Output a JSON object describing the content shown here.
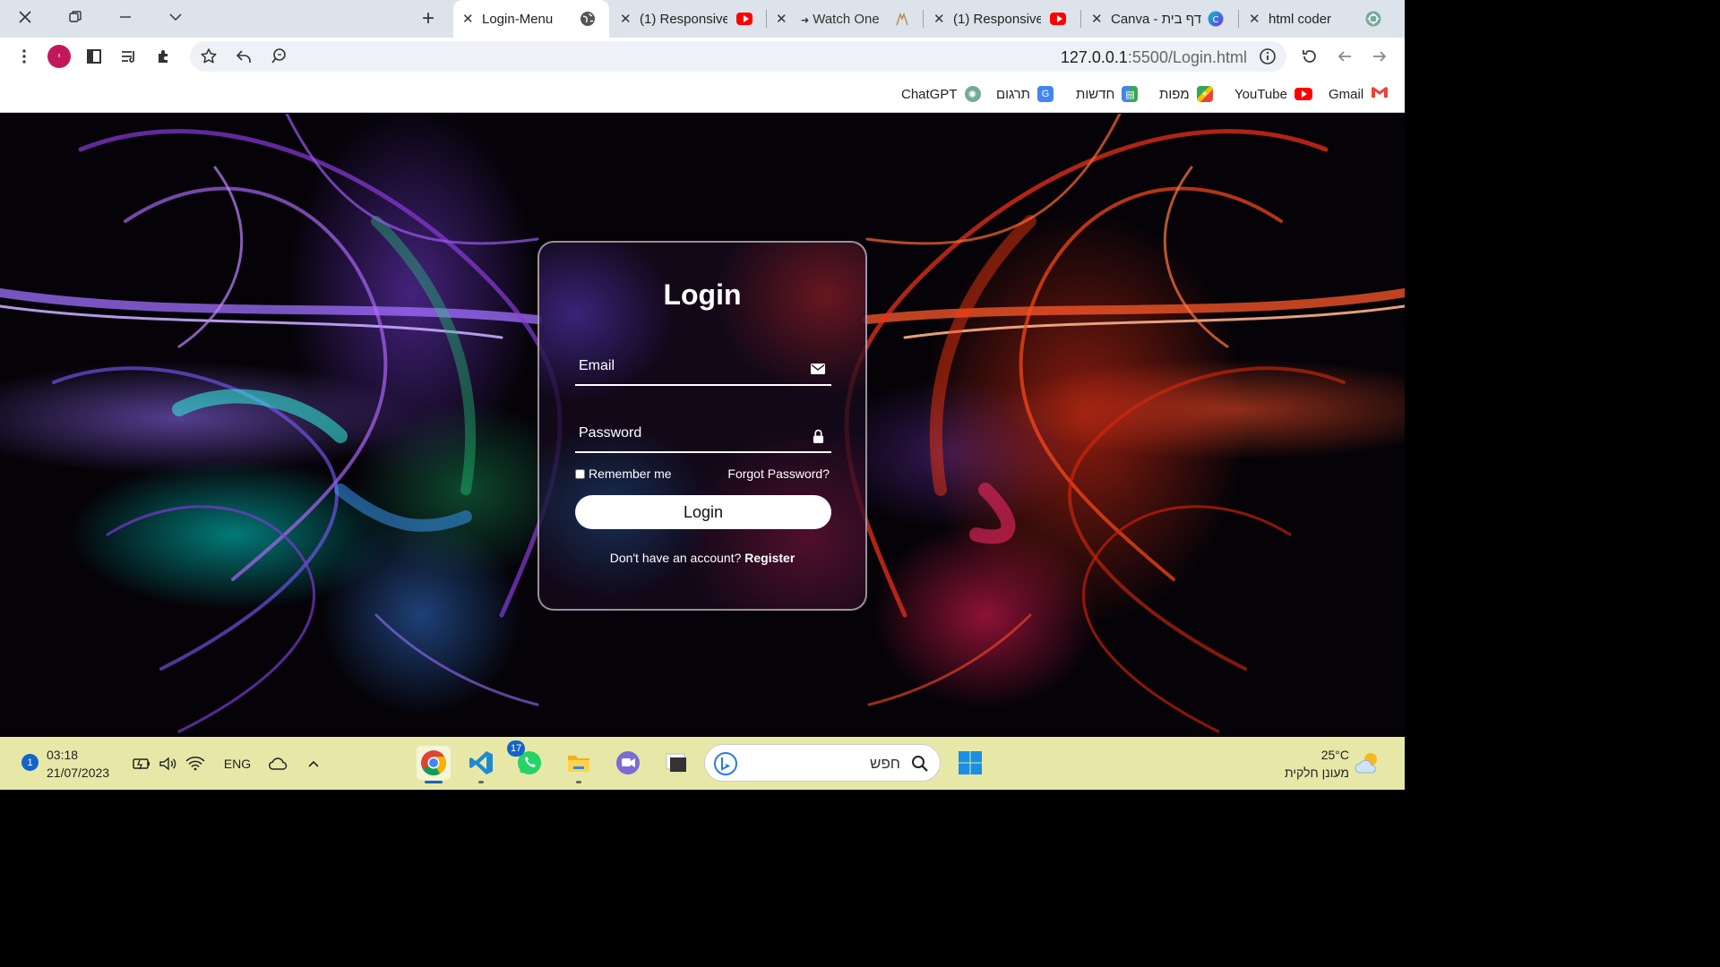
{
  "browser": {
    "new_tab_label": "+",
    "tabs": [
      {
        "title": "Login-Menu",
        "active": true,
        "favicon": "globe-icon"
      },
      {
        "title": "(1) Responsive",
        "active": false,
        "favicon": "youtube-icon"
      },
      {
        "title": "Watch One",
        "active": false,
        "favicon": "play-icon"
      },
      {
        "title": "(1) Responsive",
        "active": false,
        "favicon": "youtube-icon"
      },
      {
        "title": "Canva - דף בית",
        "active": false,
        "favicon": "canva-icon"
      },
      {
        "title": "html coder",
        "active": false,
        "favicon": "chatgpt-icon"
      }
    ],
    "profile_initial": "י",
    "url_host": "127.0.0.1",
    "url_rest": ":5500/Login.html",
    "bookmarks": [
      {
        "label": "ChatGPT",
        "icon": "chatgpt-icon"
      },
      {
        "label": "תרגום",
        "icon": "translate-icon"
      },
      {
        "label": "חדשות",
        "icon": "news-icon"
      },
      {
        "label": "מפות",
        "icon": "maps-icon"
      },
      {
        "label": "YouTube",
        "icon": "youtube-icon"
      },
      {
        "label": "Gmail",
        "icon": "gmail-icon"
      }
    ]
  },
  "login": {
    "title": "Login",
    "email_placeholder": "Email",
    "password_placeholder": "Password",
    "remember_label": "Remember me",
    "forgot_label": "Forgot Password?",
    "button_label": "Login",
    "register_prompt": "Don't have an account?",
    "register_link": "Register"
  },
  "taskbar": {
    "notification_count": "1",
    "time": "03:18",
    "date": "21/07/2023",
    "language": "ENG",
    "whatsapp_badge": "17",
    "search_placeholder": "חפש",
    "temperature": "25°C",
    "weather_desc": "מעונן חלקית"
  },
  "colors": {
    "tabstrip_bg": "#dde3ea",
    "taskbar_bg": "#e7e8a8",
    "accent": "#1464c8",
    "profile": "#c2185b"
  }
}
